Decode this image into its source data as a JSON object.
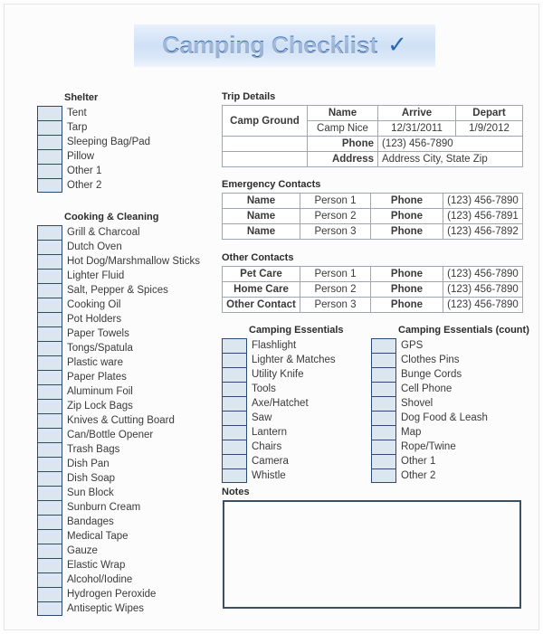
{
  "title": {
    "text": "Camping Checklist",
    "check_glyph": "✓",
    "accent_color": "#2b5ea6",
    "banner_color": "#cfe1f6"
  },
  "colors": {
    "header_blue": "#4a7ebb",
    "gray_label": "#808080",
    "checkbox_fill": "#dce6f1",
    "checkbox_border": "#2b4a74",
    "notes_border": "#3b5063"
  },
  "shelter": {
    "heading": "Shelter",
    "items": [
      "Tent",
      "Tarp",
      "Sleeping Bag/Pad",
      "Pillow",
      "Other 1",
      "Other 2"
    ]
  },
  "cooking": {
    "heading": "Cooking & Cleaning",
    "items": [
      "Grill & Charcoal",
      "Dutch Oven",
      "Hot Dog/Marshmallow Sticks",
      "Lighter Fluid",
      "Salt, Pepper & Spices",
      "Cooking Oil",
      "Pot Holders",
      "Paper Towels",
      "Tongs/Spatula",
      "Plastic ware",
      "Paper Plates",
      "Aluminum Foil",
      "Zip Lock Bags",
      "Knives & Cutting Board",
      "Can/Bottle Opener",
      "Trash Bags",
      "Dish Pan",
      "Dish Soap",
      "Sun Block",
      "Sunburn Cream",
      "Bandages",
      "Medical Tape",
      "Gauze",
      "Elastic Wrap",
      "Alcohol/Iodine",
      "Hydrogen Peroxide",
      "Antiseptic Wipes"
    ]
  },
  "essentials": {
    "heading": "Camping Essentials",
    "items": [
      "Flashlight",
      "Lighter & Matches",
      "Utility Knife",
      "Tools",
      "Axe/Hatchet",
      "Saw",
      "Lantern",
      "Chairs",
      "Camera",
      "Whistle"
    ]
  },
  "essentials_count": {
    "heading": "Camping Essentials (count)",
    "items": [
      "GPS",
      "Clothes Pins",
      "Bunge Cords",
      "Cell Phone",
      "Shovel",
      "Dog Food & Leash",
      "Map",
      "Rope/Twine",
      "Other 1",
      "Other 2"
    ]
  },
  "trip_details": {
    "heading": "Trip Details",
    "row_label": "Camp Ground",
    "columns": [
      "Name",
      "Arrive",
      "Depart"
    ],
    "values": [
      "Camp Nice",
      "12/31/2011",
      "1/9/2012"
    ],
    "phone_label": "Phone",
    "phone_value": "(123) 456-7890",
    "address_label": "Address",
    "address_value": "Address City, State Zip"
  },
  "emergency_contacts": {
    "heading": "Emergency Contacts",
    "rows": [
      {
        "name_label": "Name",
        "person": "Person 1",
        "phone_label": "Phone",
        "phone": "(123) 456-7890"
      },
      {
        "name_label": "Name",
        "person": "Person 2",
        "phone_label": "Phone",
        "phone": "(123) 456-7891"
      },
      {
        "name_label": "Name",
        "person": "Person 3",
        "phone_label": "Phone",
        "phone": "(123) 456-7892"
      }
    ]
  },
  "other_contacts": {
    "heading": "Other Contacts",
    "rows": [
      {
        "name_label": "Pet Care",
        "person": "Person 1",
        "phone_label": "Phone",
        "phone": "(123) 456-7890"
      },
      {
        "name_label": "Home Care",
        "person": "Person 2",
        "phone_label": "Phone",
        "phone": "(123) 456-7890"
      },
      {
        "name_label": "Other Contact",
        "person": "Person 3",
        "phone_label": "Phone",
        "phone": "(123) 456-7890"
      }
    ]
  },
  "notes": {
    "heading": "Notes",
    "value": ""
  }
}
